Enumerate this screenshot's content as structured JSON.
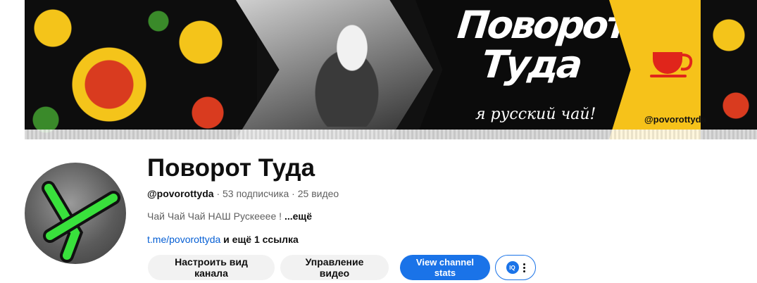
{
  "banner": {
    "title": "Поворот Туда",
    "tagline": "я русский чай!",
    "handle": "@povorottyda"
  },
  "channel": {
    "name": "Поворот Туда",
    "handle": "@povorottyda",
    "subscribers": "53 подписчика",
    "videos": "25 видео",
    "separator": "·",
    "description": "Чай Чай Чай НАШ Рускееее !",
    "description_more": "...ещё",
    "link": "t.me/povorottyda",
    "more_links": "и ещё 1 ссылка"
  },
  "buttons": {
    "customize": "Настроить вид канала",
    "manage": "Управление видео",
    "stats": "View channel stats",
    "extension_badge": "IQ"
  },
  "colors": {
    "accent_blue": "#1a73e8",
    "link_blue": "#065fd4",
    "banner_yellow": "#f6c21a",
    "cup_red": "#e0251b",
    "avatar_green": "#39e03c"
  }
}
